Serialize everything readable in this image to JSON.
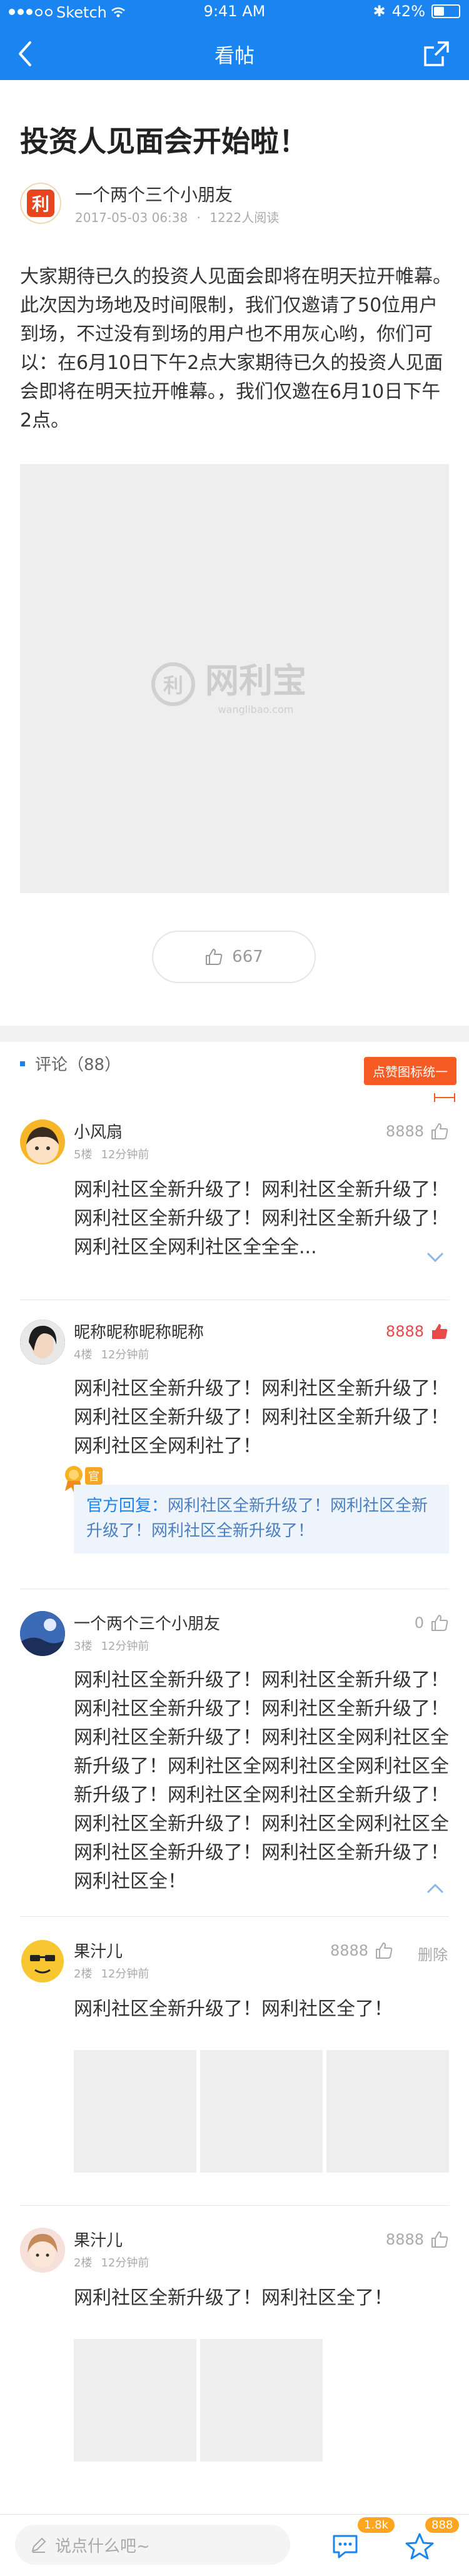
{
  "status": {
    "carrier": "Sketch",
    "time": "9:41 AM",
    "battery": "42%"
  },
  "nav": {
    "title": "看帖"
  },
  "post": {
    "title": "投资人见面会开始啦！",
    "author": "一个两个三个小朋友",
    "date": "2017-05-03 06:38",
    "reads": "1222人阅读",
    "body": "大家期待已久的投资人见面会即将在明天拉开帷幕。此次因为场地及时间限制，我们仅邀请了50位用户到场，不过没有到场的用户也不用灰心哟，你们可以：在6月10日下午2点大家期待已久的投资人见面会即将在明天拉开帷幕。，我们仅邀在6月10日下午2点。",
    "watermark_name": "网利宝",
    "watermark_url": "wanglibao.com",
    "like_count": "667"
  },
  "comments_header": {
    "label": "评论（88）",
    "tip": "点赞图标统一"
  },
  "comments": [
    {
      "name": "小风扇",
      "floor": "5楼",
      "time": "12分钟前",
      "likes": "8888",
      "text": "网利社区全新升级了！网利社区全新升级了！网利社区全新升级了！网利社区全新升级了！网利社区全网利社区全全全..."
    },
    {
      "name": "昵称昵称昵称昵称",
      "floor": "4楼",
      "time": "12分钟前",
      "likes": "8888",
      "text": "网利社区全新升级了！网利社区全新升级了！网利社区全新升级了！网利社区全新升级了！网利社区全网利社了！",
      "reply_label": "官方回复：",
      "reply_text": "网利社区全新升级了！网利社区全新升级了！网利社区全新升级了！"
    },
    {
      "name": "一个两个三个小朋友",
      "floor": "3楼",
      "time": "12分钟前",
      "likes": "0",
      "text": "网利社区全新升级了！网利社区全新升级了！网利社区全新升级了！网利社区全新升级了！网利社区全新升级了！网利社区全网利社区全新升级了！网利社区全网利社区全网利社区全新升级了！网利社区全网利社区全新升级了！网利社区全新升级了！网利社区全网利社区全网利社区全新升级了！网利社区全新升级了！网利社区全！"
    },
    {
      "name": "果汁儿",
      "floor": "2楼",
      "time": "12分钟前",
      "likes": "8888",
      "delete": "删除",
      "text": "网利社区全新升级了！网利社区全了！"
    },
    {
      "name": "果汁儿",
      "floor": "2楼",
      "time": "12分钟前",
      "likes": "8888",
      "text": "网利社区全新升级了！网利社区全了！"
    }
  ],
  "bottom": {
    "placeholder": "说点什么吧~",
    "comment_badge": "1.8k",
    "star_badge": "888"
  },
  "colors": {
    "accent": "#1a84f1",
    "highlight": "#e84a4a",
    "tip": "#f55b23"
  }
}
